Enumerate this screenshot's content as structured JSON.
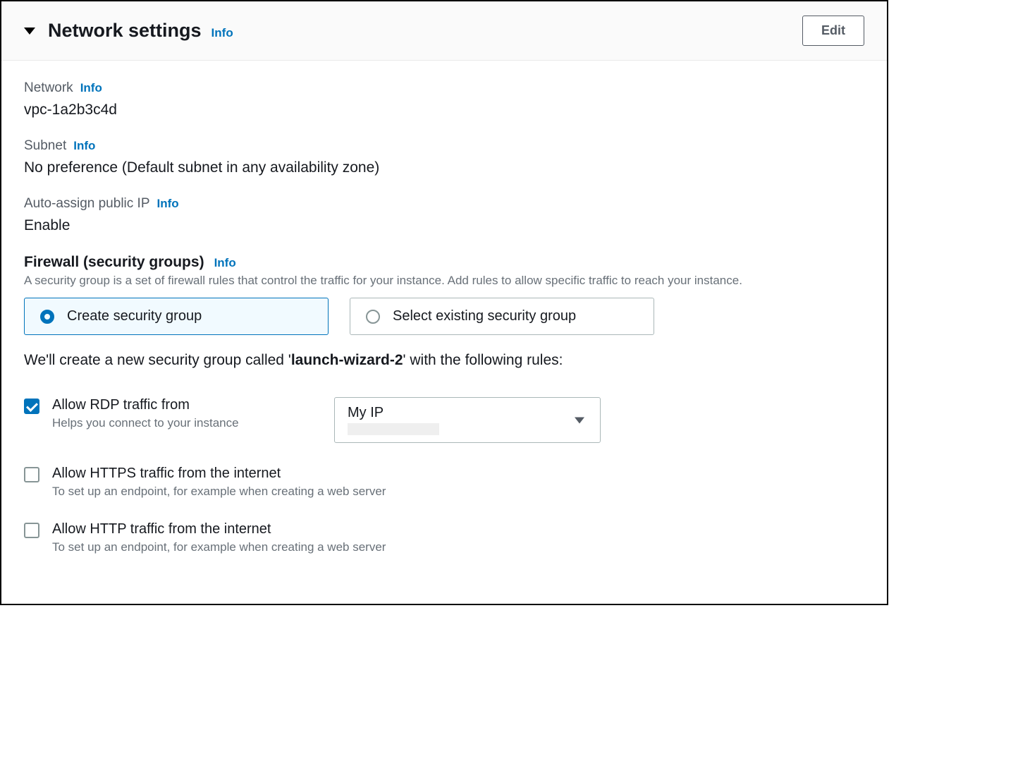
{
  "header": {
    "title": "Network settings",
    "info": "Info",
    "edit": "Edit"
  },
  "fields": {
    "network": {
      "label": "Network",
      "info": "Info",
      "value": "vpc-1a2b3c4d"
    },
    "subnet": {
      "label": "Subnet",
      "info": "Info",
      "value": "No preference (Default subnet in any availability zone)"
    },
    "publicIp": {
      "label": "Auto-assign public IP",
      "info": "Info",
      "value": "Enable"
    }
  },
  "firewall": {
    "heading": "Firewall (security groups)",
    "info": "Info",
    "description": "A security group is a set of firewall rules that control the traffic for your instance. Add rules to allow specific traffic to reach your instance.",
    "option_create": "Create security group",
    "option_select_existing": "Select existing security group",
    "note_prefix": "We'll create a new security group called '",
    "note_name": "launch-wizard-2",
    "note_suffix": "' with the following rules:"
  },
  "rules": {
    "rdp": {
      "label": "Allow RDP traffic from",
      "help": "Helps you connect to your instance",
      "checked": true,
      "source": "My IP"
    },
    "https": {
      "label": "Allow HTTPS traffic from the internet",
      "help": "To set up an endpoint, for example when creating a web server",
      "checked": false
    },
    "http": {
      "label": "Allow HTTP traffic from the internet",
      "help": "To set up an endpoint, for example when creating a web server",
      "checked": false
    }
  }
}
